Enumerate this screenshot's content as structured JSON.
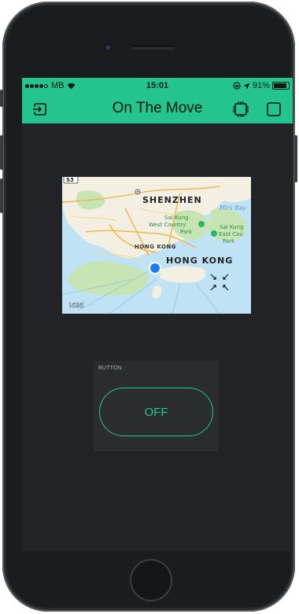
{
  "status_bar": {
    "carrier": "MB",
    "time": "15:01",
    "battery": "91%"
  },
  "header": {
    "title": "On The Move"
  },
  "map": {
    "route_badge": "S3",
    "labels": {
      "shenzhen": "SHENZHEN",
      "mirs_bay": "Mirs Bay",
      "sai_kung_west_1": "Sai Kung",
      "sai_kung_west_2": "West Country",
      "sai_kung_west_3": "Park",
      "sai_kung_east_1": "Sai Kung",
      "sai_kung_east_2": "East Cou",
      "sai_kung_east_3": "Park",
      "hong_kong_small": "HONG KONG",
      "hong_kong_large": "HONG KONG",
      "legal": "Legal"
    }
  },
  "button_widget": {
    "caption": "BUTTON",
    "state_label": "OFF"
  },
  "colors": {
    "accent": "#24c48e",
    "screen_bg": "#212327",
    "widget_bg": "#2a2c30",
    "location_dot": "#1e7cf2"
  }
}
